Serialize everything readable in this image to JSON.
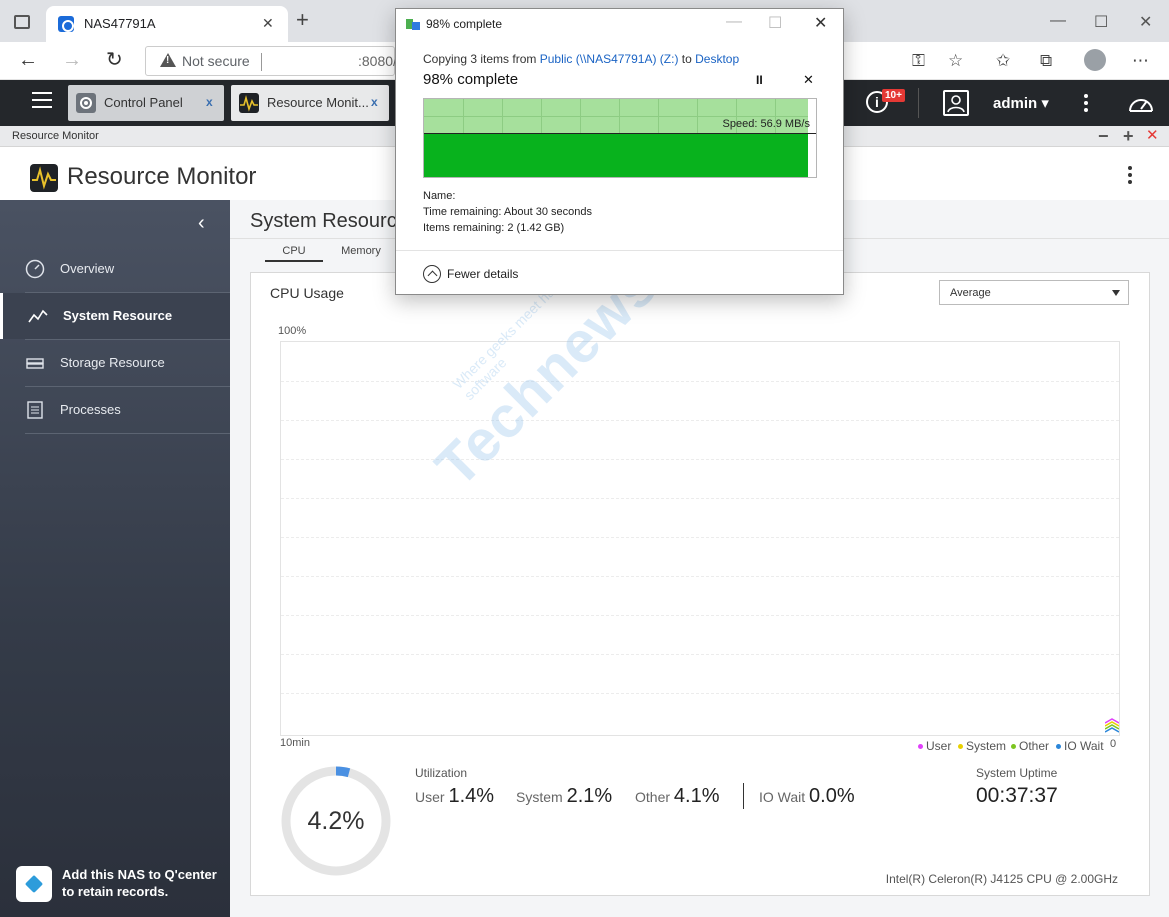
{
  "browser": {
    "tab_title": "NAS47791A",
    "new_tab": "+",
    "not_secure": "Not secure",
    "url_fragment": ":8080/",
    "minimize": "—",
    "maximize": "☐",
    "close": "✕"
  },
  "qts": {
    "tabs": [
      {
        "label": "Control Panel",
        "close": "x"
      },
      {
        "label": "Resource Monit...",
        "close": "x"
      }
    ],
    "notification_badge": "10+",
    "user": "admin"
  },
  "window": {
    "title": "Resource Monitor",
    "minimize": "−",
    "maximize": "+",
    "close": "✕"
  },
  "app": {
    "title": "Resource Monitor"
  },
  "sidebar": {
    "items": [
      {
        "label": "Overview",
        "icon": "gauge-icon"
      },
      {
        "label": "System Resource",
        "icon": "line-chart-icon"
      },
      {
        "label": "Storage Resource",
        "icon": "storage-icon"
      },
      {
        "label": "Processes",
        "icon": "list-icon"
      }
    ],
    "active_index": 1,
    "qcenter_text": "Add this NAS to Q'center to retain records."
  },
  "main": {
    "page_title": "System Resource",
    "subtabs": [
      "CPU",
      "Memory"
    ],
    "card_title": "CPU Usage",
    "select_value": "Average",
    "y_max_label": "100%",
    "x_label": "10min",
    "zero_label": "0",
    "legend": [
      {
        "name": "User",
        "color": "#e040fb"
      },
      {
        "name": "System",
        "color": "#e8d000"
      },
      {
        "name": "Other",
        "color": "#7cc520"
      },
      {
        "name": "IO Wait",
        "color": "#2b86d9"
      }
    ],
    "gauge_value": "4.2%",
    "gauge_fraction": 0.042,
    "gauge_color": "#4a90e2",
    "utilization_label": "Utilization",
    "metrics": [
      {
        "label": "User",
        "value": "1.4%"
      },
      {
        "label": "System",
        "value": "2.1%"
      },
      {
        "label": "Other",
        "value": "4.1%"
      },
      {
        "label": "IO Wait",
        "value": "0.0%"
      }
    ],
    "uptime_label": "System Uptime",
    "uptime_value": "00:37:37",
    "cpu_model": "Intel(R) Celeron(R) J4125 CPU @ 2.00GHz"
  },
  "watermark": {
    "big": "Technews.lt",
    "small": "Where geeks meet hardware and software"
  },
  "copy_dialog": {
    "title": "98% complete",
    "copy_prefix": "Copying 3 items from ",
    "source": "Public (\\\\NAS47791A) (Z:)",
    "to": " to ",
    "destination": "Desktop",
    "progress_label": "98% complete",
    "progress_fraction": 0.98,
    "pause": "II",
    "cancel": "✕",
    "speed": "Speed: 56.9 MB/s",
    "name_label": "Name:",
    "time_remaining": "Time remaining:  About 30 seconds",
    "items_remaining": "Items remaining:  2 (1.42 GB)",
    "fewer_details": "Fewer details",
    "minimize": "—",
    "maximize": "☐",
    "close": "✕"
  }
}
